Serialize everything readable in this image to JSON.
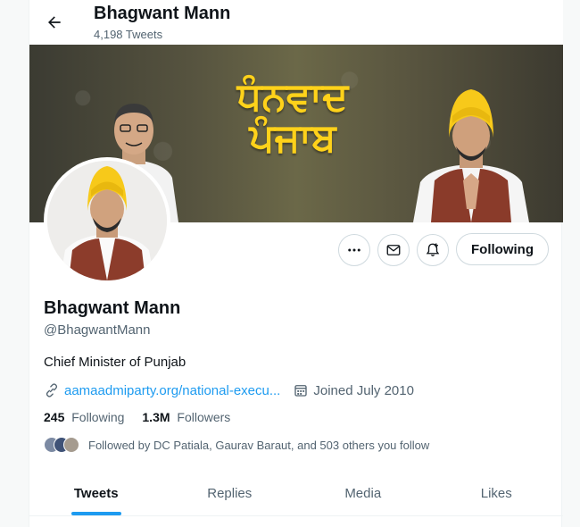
{
  "header": {
    "name": "Bhagwant Mann",
    "tweet_count": "4,198 Tweets"
  },
  "banner": {
    "text_line1": "ਧੰਨਵਾਦ",
    "text_line2": "ਪੰਜਾਬ"
  },
  "profile": {
    "name": "Bhagwant Mann",
    "handle": "@BhagwantMann",
    "bio": "Chief Minister of Punjab",
    "link": "aamaadmiparty.org/national-execu...",
    "joined": "Joined July 2010",
    "following_count": "245",
    "following_label": "Following",
    "followers_count": "1.3M",
    "followers_label": "Followers",
    "followed_by": "Followed by DC Patiala, Gaurav Baraut, and 503 others you follow"
  },
  "actions": {
    "follow_label": "Following"
  },
  "tabs": [
    {
      "label": "Tweets",
      "active": true
    },
    {
      "label": "Replies",
      "active": false
    },
    {
      "label": "Media",
      "active": false
    },
    {
      "label": "Likes",
      "active": false
    }
  ],
  "colors": {
    "accent": "#1d9bf0",
    "banner_text": "#ffd21a",
    "secondary_text": "#536471"
  }
}
